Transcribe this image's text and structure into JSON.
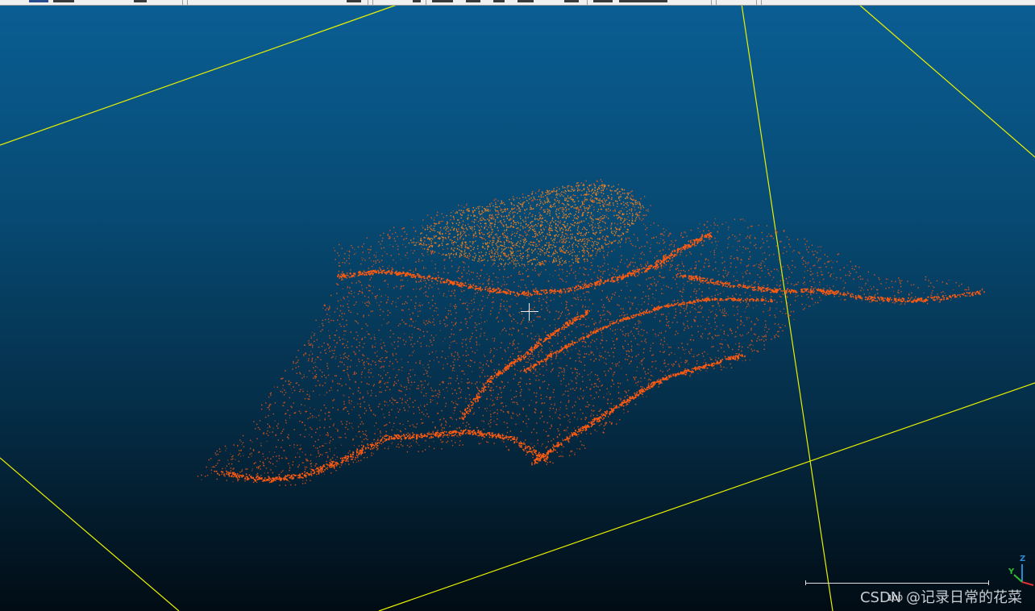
{
  "viewer": {
    "background_top_color": "#0a5e94",
    "background_bottom_color": "#010c14",
    "grid_color": "#e8f000",
    "point_color": "#ff5a10",
    "point_highlight_color": "#ff8a1e"
  },
  "scale_bar": {
    "label": "100"
  },
  "axis_triad": {
    "x_label": "X",
    "y_label": "Y",
    "z_label": "Z",
    "x_color": "#e03030",
    "y_color": "#30c030",
    "z_color": "#2a8ad0"
  },
  "watermark": {
    "text": "CSDN @记录日常的花菜"
  },
  "icons": {
    "crosshair": "crosshair-icon"
  }
}
